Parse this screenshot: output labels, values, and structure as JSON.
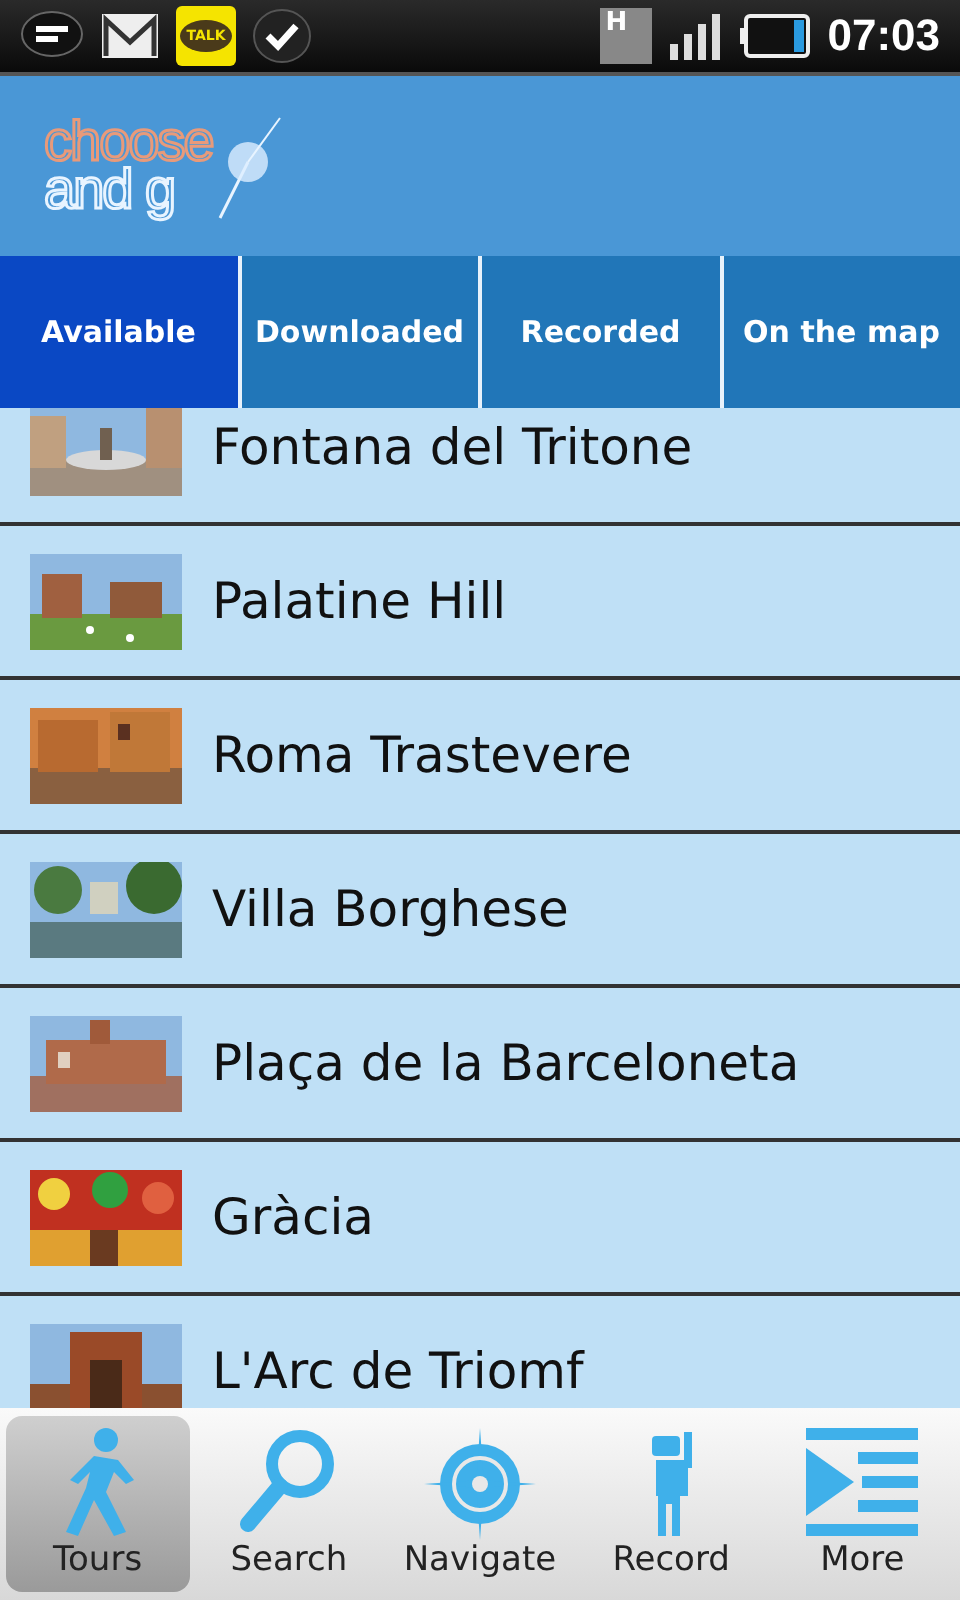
{
  "status_bar": {
    "talk_label": "TALK",
    "network_label": "H",
    "time": "07:03"
  },
  "logo": {
    "line_1": "choose",
    "line_2": "and g"
  },
  "tabs": [
    {
      "label": "Available",
      "selected": true
    },
    {
      "label": "Downloaded",
      "selected": false
    },
    {
      "label": "Recorded",
      "selected": false
    },
    {
      "label": "On the map",
      "selected": false
    }
  ],
  "tours": [
    {
      "name": "Fontana del Tritone"
    },
    {
      "name": "Palatine Hill"
    },
    {
      "name": "Roma Trastevere"
    },
    {
      "name": "Villa Borghese"
    },
    {
      "name": "Plaça de la Barceloneta"
    },
    {
      "name": "Gràcia"
    },
    {
      "name": "L'Arc de Triomf"
    }
  ],
  "nav": [
    {
      "label": "Tours",
      "selected": true
    },
    {
      "label": "Search",
      "selected": false
    },
    {
      "label": "Navigate",
      "selected": false
    },
    {
      "label": "Record",
      "selected": false
    },
    {
      "label": "More",
      "selected": false
    }
  ]
}
